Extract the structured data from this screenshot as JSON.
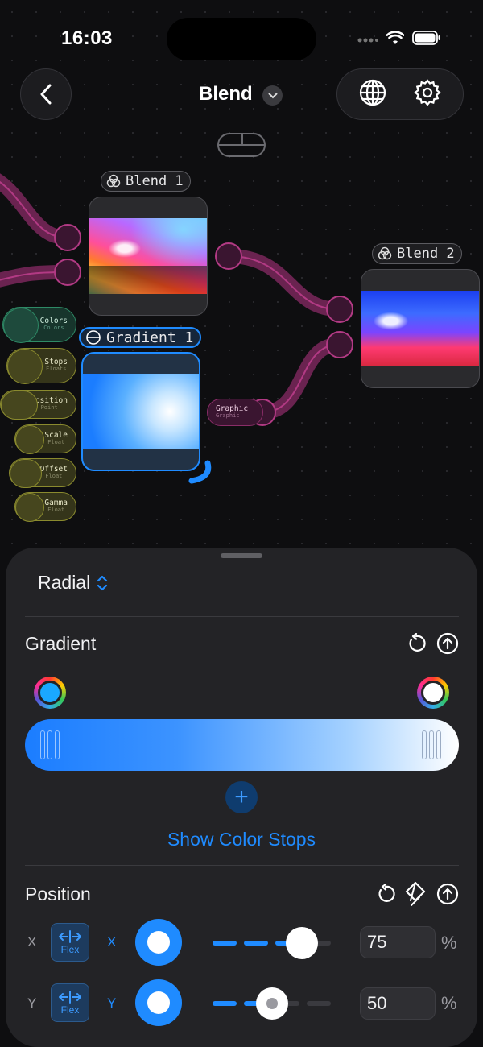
{
  "status": {
    "time": "16:03"
  },
  "header": {
    "title": "Blend"
  },
  "nodes": {
    "blend1": {
      "label": "Blend 1"
    },
    "blend2": {
      "label": "Blend 2"
    },
    "gradient1": {
      "label": "Gradient 1"
    },
    "graphic_port": {
      "label": "Graphic",
      "type": "Graphic"
    }
  },
  "inputs": [
    {
      "label": "Colors",
      "type": "Colors"
    },
    {
      "label": "Stops",
      "type": "Floats"
    },
    {
      "label": "Position",
      "type": "Point"
    },
    {
      "label": "Scale",
      "type": "Float"
    },
    {
      "label": "Offset",
      "type": "Float"
    },
    {
      "label": "Gamma",
      "type": "Float"
    }
  ],
  "sheet": {
    "mode": "Radial",
    "gradient_title": "Gradient",
    "show_stops": "Show Color Stops",
    "position_title": "Position",
    "x": {
      "axis": "X",
      "flex": "Flex",
      "toggle": "X",
      "value": "75",
      "unit": "%",
      "slider": 0.75
    },
    "y": {
      "axis": "Y",
      "flex": "Flex",
      "toggle": "Y",
      "value": "50",
      "unit": "%",
      "slider": 0.5
    },
    "colors": {
      "accent": "#1f8bff",
      "stop_start": "#1aa8ff",
      "stop_end": "#ffffff"
    }
  }
}
